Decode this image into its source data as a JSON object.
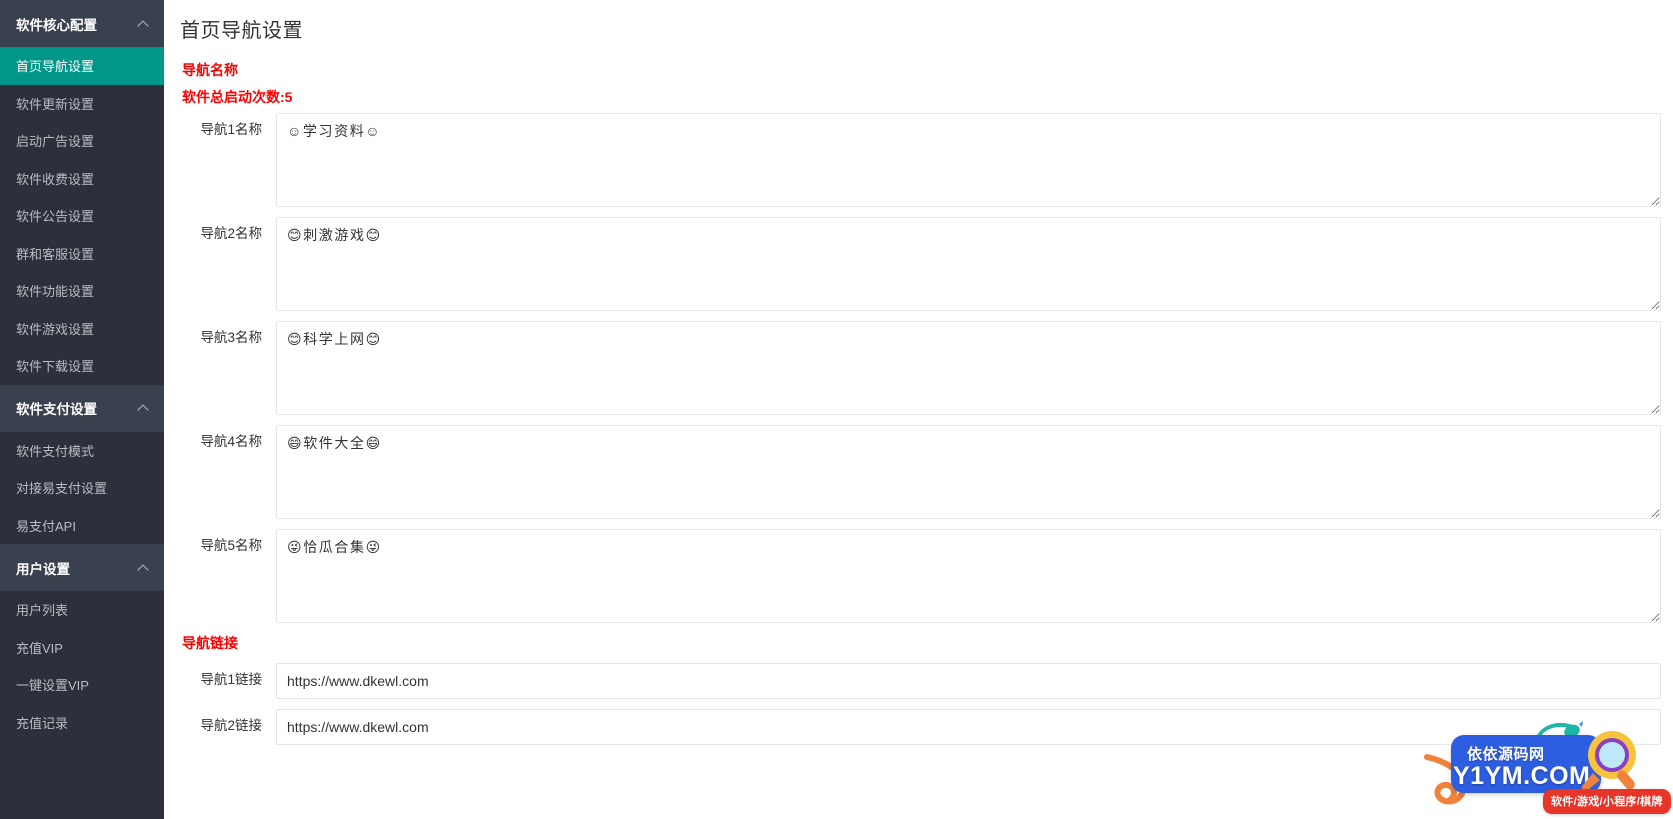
{
  "sidebar": {
    "groups": [
      {
        "label": "软件核心配置",
        "icon": "chevron-up-icon",
        "items": [
          {
            "label": "首页导航设置",
            "active": true
          },
          {
            "label": "软件更新设置",
            "active": false
          },
          {
            "label": "启动广告设置",
            "active": false
          },
          {
            "label": "软件收费设置",
            "active": false
          },
          {
            "label": "软件公告设置",
            "active": false
          },
          {
            "label": "群和客服设置",
            "active": false
          },
          {
            "label": "软件功能设置",
            "active": false
          },
          {
            "label": "软件游戏设置",
            "active": false
          },
          {
            "label": "软件下载设置",
            "active": false
          }
        ]
      },
      {
        "label": "软件支付设置",
        "icon": "chevron-up-icon",
        "items": [
          {
            "label": "软件支付模式",
            "active": false
          },
          {
            "label": "对接易支付设置",
            "active": false
          },
          {
            "label": "易支付API",
            "active": false
          }
        ]
      },
      {
        "label": "用户设置",
        "icon": "chevron-up-icon",
        "items": [
          {
            "label": "用户列表",
            "active": false
          },
          {
            "label": "充值VIP",
            "active": false
          },
          {
            "label": "一键设置VIP",
            "active": false
          },
          {
            "label": "充值记录",
            "active": false
          }
        ]
      }
    ]
  },
  "main": {
    "page_title": "首页导航设置",
    "name_section": {
      "heading": "导航名称",
      "launch_count_text": "软件总启动次数:5",
      "fields": [
        {
          "label": "导航1名称",
          "value": "☺学习资料☺"
        },
        {
          "label": "导航2名称",
          "value": "😊刺激游戏😊"
        },
        {
          "label": "导航3名称",
          "value": "😊科学上网😊"
        },
        {
          "label": "导航4名称",
          "value": "😄软件大全😄"
        },
        {
          "label": "导航5名称",
          "value": "😜恰瓜合集😜"
        }
      ]
    },
    "link_section": {
      "heading": "导航链接",
      "fields": [
        {
          "label": "导航1链接",
          "value": "https://www.dkewl.com"
        },
        {
          "label": "导航2链接",
          "value": "https://www.dkewl.com"
        }
      ]
    }
  },
  "watermark": {
    "cn_name": "依依源码网",
    "domain": "Y1YM.COM",
    "tagline": "软件/游戏/小程序/棋牌"
  },
  "colors": {
    "sidebar_bg": "#2b303b",
    "sidebar_group_bg": "#39404e",
    "active_item": "#009688",
    "section_label": "#ff0000",
    "watermark_blue": "#2d5de0",
    "watermark_red": "#e8352a"
  }
}
